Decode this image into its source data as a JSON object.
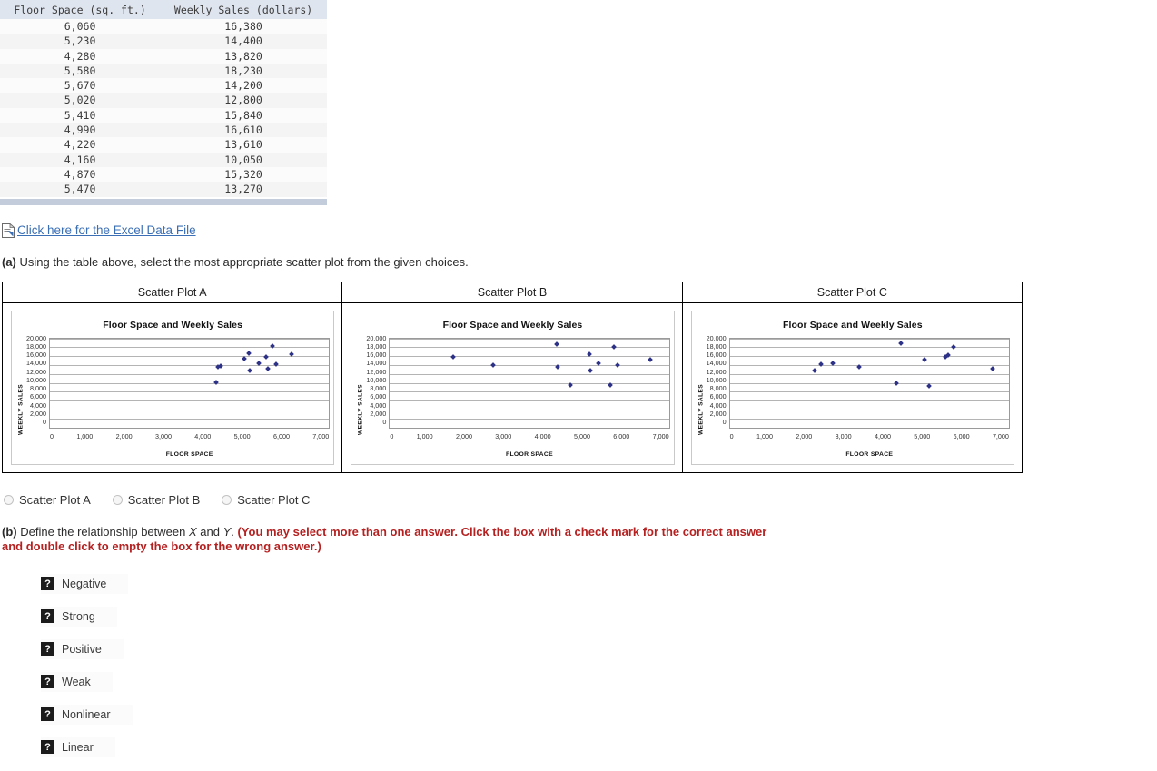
{
  "table": {
    "headers": [
      "Floor Space (sq. ft.)",
      "Weekly Sales (dollars)"
    ],
    "rows": [
      [
        "6,060",
        "16,380"
      ],
      [
        "5,230",
        "14,400"
      ],
      [
        "4,280",
        "13,820"
      ],
      [
        "5,580",
        "18,230"
      ],
      [
        "5,670",
        "14,200"
      ],
      [
        "5,020",
        "12,800"
      ],
      [
        "5,410",
        "15,840"
      ],
      [
        "4,990",
        "16,610"
      ],
      [
        "4,220",
        "13,610"
      ],
      [
        "4,160",
        "10,050"
      ],
      [
        "4,870",
        "15,320"
      ],
      [
        "5,470",
        "13,270"
      ]
    ]
  },
  "excel_link": {
    "icon": "excel-file-icon",
    "text": " Click here for the Excel Data File"
  },
  "question_a": {
    "label": "(a)",
    "text": " Using the table above, select the most appropriate scatter plot from the given choices."
  },
  "question_b": {
    "label": "(b)",
    "text_1": " Define the relationship between ",
    "var_x": "X",
    "text_2": " and ",
    "var_y": "Y",
    "text_3": ". ",
    "red_text": "(You may select more than one answer. Click the box with a check mark for the correct answer and double click to empty the box for the wrong answer.)"
  },
  "plot_headers": [
    "Scatter Plot A",
    "Scatter Plot B",
    "Scatter Plot C"
  ],
  "radio_options": [
    {
      "label": "Scatter Plot A",
      "selected": false
    },
    {
      "label": "Scatter Plot B",
      "selected": false
    },
    {
      "label": "Scatter Plot C",
      "selected": false
    }
  ],
  "check_options": [
    {
      "label": "Negative",
      "glyph": "?"
    },
    {
      "label": "Strong",
      "glyph": "?"
    },
    {
      "label": "Positive",
      "glyph": "?"
    },
    {
      "label": "Weak",
      "glyph": "?"
    },
    {
      "label": "Nonlinear",
      "glyph": "?"
    },
    {
      "label": "Linear",
      "glyph": "?"
    }
  ],
  "colors": {
    "marker": "#2e3287",
    "link": "#3a6fb5",
    "red_instruction": "#b52020",
    "table_header_bg": "#dfe5ee",
    "table_footer_strip": "#c3ccda"
  },
  "chart_data": [
    {
      "type": "scatter",
      "name": "Scatter Plot A",
      "title": "Floor Space and Weekly Sales",
      "xlabel": "FLOOR SPACE",
      "ylabel": "WEEKLY SALES",
      "xlim": [
        0,
        7000
      ],
      "ylim": [
        0,
        20000
      ],
      "xticks": [
        "0",
        "1,000",
        "2,000",
        "3,000",
        "4,000",
        "5,000",
        "6,000",
        "7,000"
      ],
      "yticks": [
        "20,000",
        "18,000",
        "16,000",
        "14,000",
        "12,000",
        "10,000",
        "8,000",
        "6,000",
        "4,000",
        "2,000",
        "0"
      ],
      "grid": true,
      "legend": "none",
      "points": [
        {
          "x": 6060,
          "y": 16380
        },
        {
          "x": 5230,
          "y": 14400
        },
        {
          "x": 4280,
          "y": 13820
        },
        {
          "x": 5580,
          "y": 18230
        },
        {
          "x": 5670,
          "y": 14200
        },
        {
          "x": 5020,
          "y": 12800
        },
        {
          "x": 5410,
          "y": 15840
        },
        {
          "x": 4990,
          "y": 16610
        },
        {
          "x": 4220,
          "y": 13610
        },
        {
          "x": 4160,
          "y": 10050
        },
        {
          "x": 4870,
          "y": 15320
        },
        {
          "x": 5470,
          "y": 13270
        }
      ]
    },
    {
      "type": "scatter",
      "name": "Scatter Plot B",
      "title": "Floor Space and Weekly Sales",
      "xlabel": "FLOOR SPACE",
      "ylabel": "WEEKLY SALES",
      "xlim": [
        0,
        7000
      ],
      "ylim": [
        0,
        20000
      ],
      "xticks": [
        "0",
        "1,000",
        "2,000",
        "3,000",
        "4,000",
        "5,000",
        "6,000",
        "7,000"
      ],
      "yticks": [
        "20,000",
        "18,000",
        "16,000",
        "14,000",
        "12,000",
        "10,000",
        "8,000",
        "6,000",
        "4,000",
        "2,000",
        "0"
      ],
      "grid": true,
      "legend": "none",
      "points": [
        {
          "x": 1580,
          "y": 15900
        },
        {
          "x": 2580,
          "y": 13900
        },
        {
          "x": 4180,
          "y": 18600
        },
        {
          "x": 4200,
          "y": 13500
        },
        {
          "x": 4520,
          "y": 9500
        },
        {
          "x": 5000,
          "y": 16500
        },
        {
          "x": 5020,
          "y": 12800
        },
        {
          "x": 5230,
          "y": 14300
        },
        {
          "x": 5520,
          "y": 9500
        },
        {
          "x": 5620,
          "y": 18100
        },
        {
          "x": 5700,
          "y": 14000
        },
        {
          "x": 6520,
          "y": 15300
        }
      ]
    },
    {
      "type": "scatter",
      "name": "Scatter Plot C",
      "title": "Floor Space and Weekly Sales",
      "xlabel": "FLOOR SPACE",
      "ylabel": "WEEKLY SALES",
      "xlim": [
        0,
        7000
      ],
      "ylim": [
        0,
        20000
      ],
      "xticks": [
        "0",
        "1,000",
        "2,000",
        "3,000",
        "4,000",
        "5,000",
        "6,000",
        "7,000"
      ],
      "yticks": [
        "20,000",
        "18,000",
        "16,000",
        "14,000",
        "12,000",
        "10,000",
        "8,000",
        "6,000",
        "4,000",
        "2,000",
        "0"
      ],
      "grid": true,
      "legend": "none",
      "points": [
        {
          "x": 2120,
          "y": 12800
        },
        {
          "x": 2280,
          "y": 14100
        },
        {
          "x": 2580,
          "y": 14300
        },
        {
          "x": 3250,
          "y": 13500
        },
        {
          "x": 4180,
          "y": 10000
        },
        {
          "x": 4300,
          "y": 18900
        },
        {
          "x": 4880,
          "y": 15300
        },
        {
          "x": 5000,
          "y": 9200
        },
        {
          "x": 5400,
          "y": 15900
        },
        {
          "x": 5470,
          "y": 16200
        },
        {
          "x": 5600,
          "y": 18100
        },
        {
          "x": 6580,
          "y": 13200
        }
      ]
    }
  ]
}
